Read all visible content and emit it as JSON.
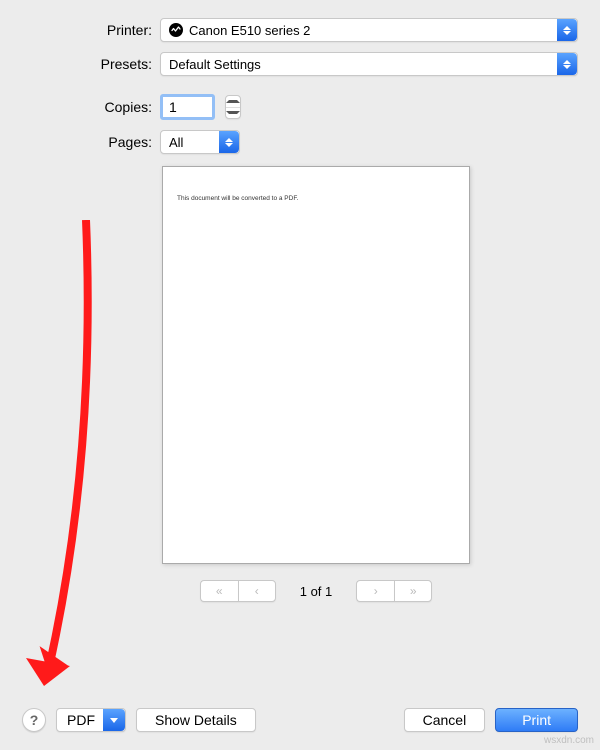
{
  "labels": {
    "printer": "Printer:",
    "presets": "Presets:",
    "copies": "Copies:",
    "pages": "Pages:"
  },
  "printer": {
    "selected": "Canon E510 series 2"
  },
  "presets": {
    "selected": "Default Settings"
  },
  "copies": {
    "value": "1"
  },
  "pages": {
    "selected": "All"
  },
  "preview": {
    "text": "This document will be converted to a PDF."
  },
  "pager": {
    "label": "1 of 1"
  },
  "bottom": {
    "help": "?",
    "pdf": "PDF",
    "show_details": "Show Details",
    "cancel": "Cancel",
    "print": "Print"
  },
  "watermark": "wsxdn.com"
}
